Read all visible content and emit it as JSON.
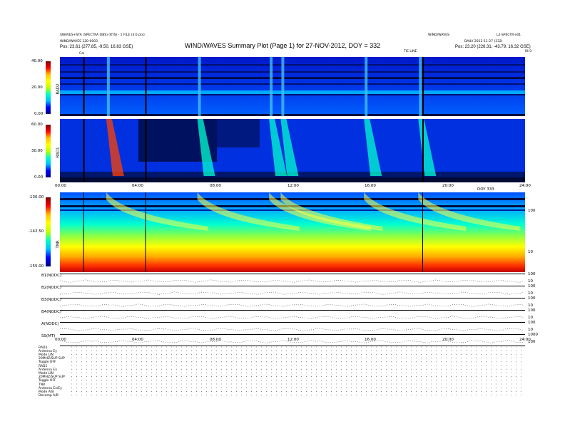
{
  "header": {
    "left_line1": "SWAVES+STA (SPECTRA OBS) (RTS) - 1 FILE (3:0 pts)",
    "left_line2": "WIND/WAVES 120-0003",
    "left_line3": "Pos:  23.61 (277.85, -9.50, 16.83 GSE)",
    "right_line1": "WIND/WAVES",
    "right_line2": "DAILY 2012-11-27 (332)",
    "right_line3": "Pos:  23.20 (226.31, -43.79, 16.32 GSE)",
    "right_id": "L2-SPECTR-v01",
    "title": "WIND/WAVES Summary Plot (Page 1) for 27-NOV-2012, DOY = 332",
    "marker_cal": "Cal",
    "marker_mid": "TIE LINE",
    "marker_rh": "RH3"
  },
  "rad2": {
    "label": "RAD2",
    "ticks": [
      "40.00",
      "20.00",
      "0.00"
    ]
  },
  "rad1": {
    "label": "RAD1",
    "ticks": [
      "60.00",
      "30.00",
      "0.00"
    ]
  },
  "tnr": {
    "label": "TNR",
    "ticks": [
      "-130.00",
      "-142.50",
      "-155.00"
    ],
    "right_ticks": [
      "100",
      "10"
    ],
    "corner": "DOY 333"
  },
  "time_ticks": [
    "00:00",
    "04:00",
    "08:00",
    "12:00",
    "16:00",
    "20:00",
    "24:00"
  ],
  "lower_rows": [
    {
      "label": "B1(NODC)",
      "values": [
        "100",
        "10"
      ]
    },
    {
      "label": "B2(NODC)",
      "values": [
        "100",
        "10"
      ]
    },
    {
      "label": "B3(NODC)",
      "values": [
        "100",
        "10"
      ]
    },
    {
      "label": "B4(NODC)",
      "values": [
        "100",
        "10"
      ]
    },
    {
      "label": "A(NODC)",
      "values": [
        "100",
        "10"
      ]
    },
    {
      "label": "SS(MT)",
      "values": [
        "1000",
        "100"
      ]
    }
  ],
  "status": {
    "rad2": [
      "RAD2",
      "Antenna  Ey",
      "Mode  LIN",
      "20MHZ/SUP  SUP",
      "Toggle  OFF"
    ],
    "rad1": [
      "RAD1",
      "Antenna  Ex",
      "Mode  LIN",
      "20MHZ/SUP  SUP",
      "Toggle  OFF"
    ],
    "tnr": [
      "TNR",
      "Antenna  Ex/Ey",
      "Mode  A/B",
      "Decomp  A/B"
    ]
  },
  "colors": {
    "bg_dark": "#000080",
    "accent": "#0030ff"
  },
  "chart_data": {
    "type": "heatmap",
    "title": "WIND/WAVES Summary Plot (Page 1) for 27-NOV-2012, DOY = 332",
    "x": [
      "00:00",
      "04:00",
      "08:00",
      "12:00",
      "16:00",
      "20:00",
      "24:00"
    ],
    "xlim": [
      "00:00",
      "24:00"
    ],
    "panels": [
      {
        "name": "RAD2",
        "ylim": [
          0,
          40
        ],
        "yticks": [
          0,
          20,
          40
        ]
      },
      {
        "name": "RAD1",
        "ylim": [
          0,
          60
        ],
        "yticks": [
          0,
          30,
          60
        ]
      },
      {
        "name": "TNR",
        "ylim": [
          -155,
          -130
        ],
        "yticks": [
          -155,
          -142.5,
          -130
        ]
      }
    ],
    "bursts_hours": [
      2.5,
      7.2,
      10.9,
      11.5,
      15.8,
      18.6
    ],
    "colormap": [
      "#00007f",
      "#0000ff",
      "#00bfff",
      "#00ffbf",
      "#bfff00",
      "#ffbf00",
      "#ff0000",
      "#7f0000"
    ]
  }
}
